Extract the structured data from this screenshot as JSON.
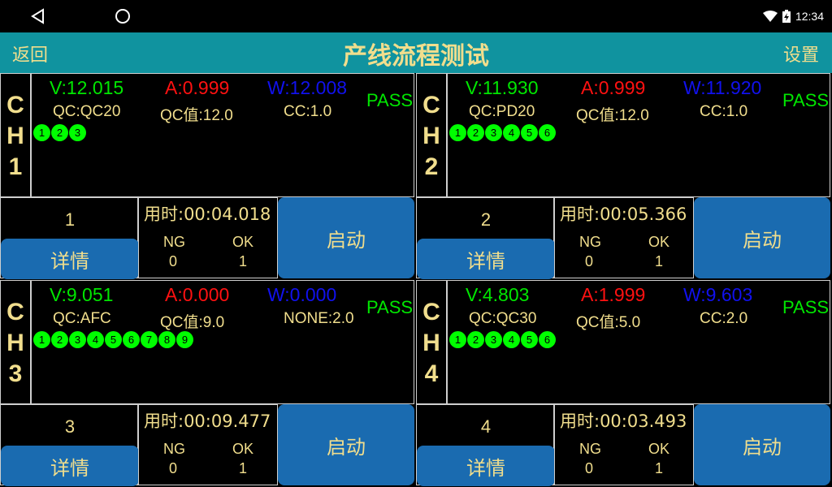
{
  "status_bar": {
    "time": "12:34"
  },
  "header": {
    "back": "返回",
    "title": "产线流程测试",
    "settings": "设置"
  },
  "channels": [
    {
      "label": [
        "C",
        "H",
        "1"
      ],
      "v": "V:12.015",
      "a": "A:0.999",
      "w": "W:12.008",
      "qc": "QC:QC20",
      "qc_value": "QC值:12.0",
      "cc": "CC:1.0",
      "result": "PASS",
      "steps": [
        "1",
        "2",
        "3"
      ],
      "index": "1",
      "detail": "详情",
      "time": "用时:00:04.018",
      "ng_label": "NG",
      "ng": "0",
      "ok_label": "OK",
      "ok": "1",
      "start": "启动"
    },
    {
      "label": [
        "C",
        "H",
        "2"
      ],
      "v": "V:11.930",
      "a": "A:0.999",
      "w": "W:11.920",
      "qc": "QC:PD20",
      "qc_value": "QC值:12.0",
      "cc": "CC:1.0",
      "result": "PASS",
      "steps": [
        "1",
        "2",
        "3",
        "4",
        "5",
        "6"
      ],
      "index": "2",
      "detail": "详情",
      "time": "用时:00:05.366",
      "ng_label": "NG",
      "ng": "0",
      "ok_label": "OK",
      "ok": "1",
      "start": "启动"
    },
    {
      "label": [
        "C",
        "H",
        "3"
      ],
      "v": "V:9.051",
      "a": "A:0.000",
      "w": "W:0.000",
      "qc": "QC:AFC",
      "qc_value": "QC值:9.0",
      "cc": "NONE:2.0",
      "result": "PASS",
      "steps": [
        "1",
        "2",
        "3",
        "4",
        "5",
        "6",
        "7",
        "8",
        "9"
      ],
      "index": "3",
      "detail": "详情",
      "time": "用时:00:09.477",
      "ng_label": "NG",
      "ng": "0",
      "ok_label": "OK",
      "ok": "1",
      "start": "启动"
    },
    {
      "label": [
        "C",
        "H",
        "4"
      ],
      "v": "V:4.803",
      "a": "A:1.999",
      "w": "W:9.603",
      "qc": "QC:QC30",
      "qc_value": "QC值:5.0",
      "cc": "CC:2.0",
      "result": "PASS",
      "steps": [
        "1",
        "2",
        "3",
        "4",
        "5",
        "6"
      ],
      "index": "4",
      "detail": "详情",
      "time": "用时:00:03.493",
      "ng_label": "NG",
      "ng": "0",
      "ok_label": "OK",
      "ok": "1",
      "start": "启动"
    }
  ]
}
